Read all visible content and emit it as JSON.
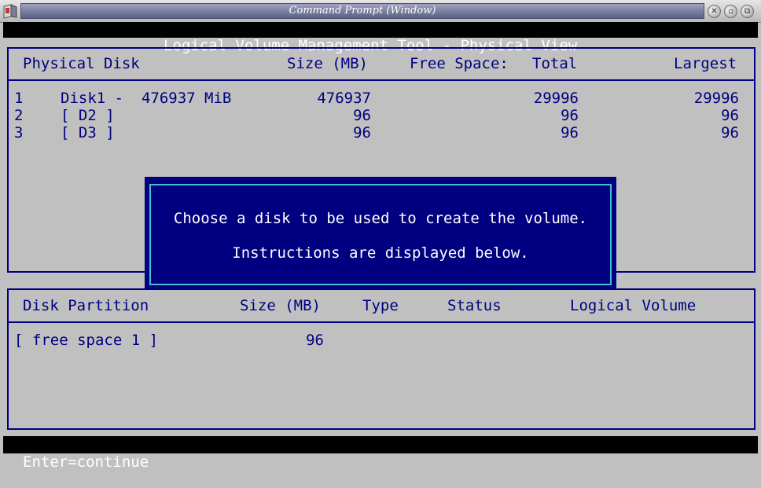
{
  "window": {
    "title": "Command Prompt (Window)"
  },
  "header": {
    "title": "Logical Volume Management Tool - Physical View"
  },
  "disks_table": {
    "columns": [
      "Physical Disk",
      "Size (MB)",
      "Free Space:",
      "Total",
      "Largest"
    ],
    "rows": [
      {
        "index": "1",
        "name": "Disk1 -  476937 MiB",
        "size": "476937",
        "total": "29996",
        "largest": "29996"
      },
      {
        "index": "2",
        "name": "[ D2 ]",
        "size": "96",
        "total": "96",
        "largest": "96"
      },
      {
        "index": "3",
        "name": "[ D3 ]",
        "size": "96",
        "total": "96",
        "largest": "96"
      }
    ]
  },
  "partitions_table": {
    "columns": [
      "Disk Partition",
      "Size (MB)",
      "Type",
      "Status",
      "Logical Volume"
    ],
    "rows": [
      {
        "name": "[ free space 1 ]",
        "size": "96",
        "type": "",
        "status": "",
        "volume": ""
      }
    ]
  },
  "dialog": {
    "line1": "Choose a disk to be used to create the volume.",
    "line2": "Instructions are displayed below."
  },
  "status_bar": {
    "text": "Enter=continue"
  },
  "colors": {
    "panel_text": "#000080",
    "background": "#c0c0c0",
    "dialog_bg": "#000080",
    "dialog_border": "#40c0d0"
  }
}
